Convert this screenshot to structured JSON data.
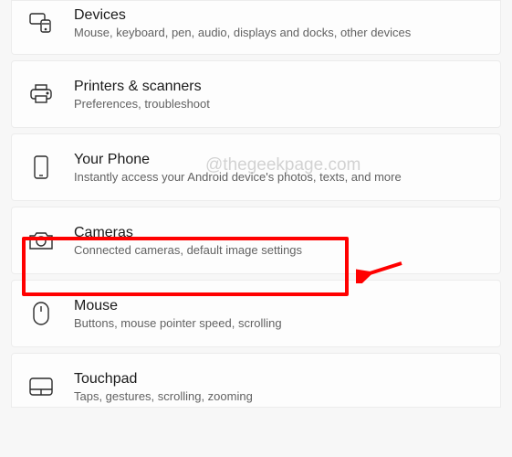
{
  "watermark": "@thegeekpage.com",
  "items": [
    {
      "title": "Devices",
      "desc": "Mouse, keyboard, pen, audio, displays and docks, other devices"
    },
    {
      "title": "Printers & scanners",
      "desc": "Preferences, troubleshoot"
    },
    {
      "title": "Your Phone",
      "desc": "Instantly access your Android device's photos, texts, and more"
    },
    {
      "title": "Cameras",
      "desc": "Connected cameras, default image settings"
    },
    {
      "title": "Mouse",
      "desc": "Buttons, mouse pointer speed, scrolling"
    },
    {
      "title": "Touchpad",
      "desc": "Taps, gestures, scrolling, zooming"
    }
  ]
}
